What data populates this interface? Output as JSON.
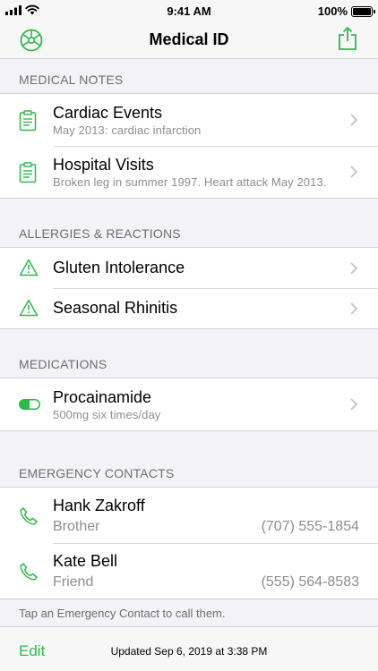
{
  "status_bar": {
    "time": "9:41 AM",
    "battery": "100%"
  },
  "nav": {
    "title": "Medical ID"
  },
  "sections": {
    "medical_notes": {
      "header": "MEDICAL NOTES",
      "items": [
        {
          "title": "Cardiac Events",
          "subtitle": "May 2013: cardiac infarction"
        },
        {
          "title": "Hospital Visits",
          "subtitle": "Broken leg in summer 1997.  Heart attack May 2013."
        }
      ]
    },
    "allergies": {
      "header": "ALLERGIES & REACTIONS",
      "items": [
        {
          "title": "Gluten Intolerance"
        },
        {
          "title": "Seasonal Rhinitis"
        }
      ]
    },
    "medications": {
      "header": "MEDICATIONS",
      "items": [
        {
          "title": "Procainamide",
          "subtitle": "500mg six times/day"
        }
      ]
    },
    "emergency_contacts": {
      "header": "EMERGENCY CONTACTS",
      "items": [
        {
          "name": "Hank Zakroff",
          "relation": "Brother",
          "phone": "(707) 555-1854"
        },
        {
          "name": "Kate Bell",
          "relation": "Friend",
          "phone": "(555) 564-8583"
        }
      ],
      "footnote": "Tap an Emergency Contact to call them."
    }
  },
  "bottom_bar": {
    "edit_label": "Edit",
    "updated_text": "Updated Sep 6, 2019 at 3:38 PM"
  },
  "colors": {
    "accent": "#2fb94a",
    "secondary_text": "#8e8e93",
    "header_text": "#6d6d72",
    "background": "#f2f2f7"
  }
}
